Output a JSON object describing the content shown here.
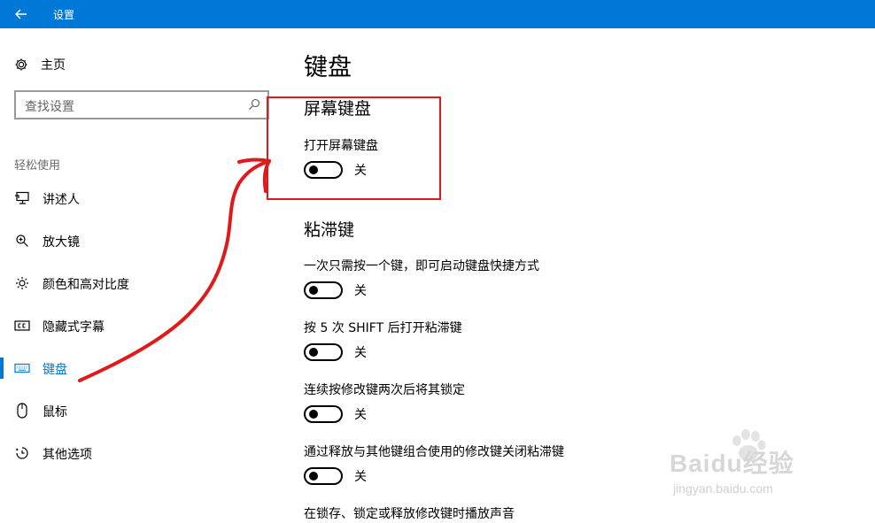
{
  "window": {
    "title": "设置"
  },
  "sidebar": {
    "home_label": "主页",
    "search_placeholder": "查找设置",
    "section_label": "轻松使用",
    "items": [
      {
        "label": "讲述人",
        "icon": "narrator-icon"
      },
      {
        "label": "放大镜",
        "icon": "magnifier-icon"
      },
      {
        "label": "颜色和高对比度",
        "icon": "brightness-icon"
      },
      {
        "label": "隐藏式字幕",
        "icon": "closed-caption-icon"
      },
      {
        "label": "键盘",
        "icon": "keyboard-icon",
        "selected": true
      },
      {
        "label": "鼠标",
        "icon": "mouse-icon"
      },
      {
        "label": "其他选项",
        "icon": "other-options-icon"
      }
    ]
  },
  "main": {
    "page_title": "键盘",
    "onscreen": {
      "title": "屏幕键盘",
      "setting_label": "打开屏幕键盘",
      "toggle_state": "关"
    },
    "sticky": {
      "title": "粘滞键",
      "settings": [
        {
          "label": "一次只需按一个键，即可启动键盘快捷方式",
          "state": "关"
        },
        {
          "label": "按 5 次 SHIFT 后打开粘滞键",
          "state": "关"
        },
        {
          "label": "连续按修改键两次后将其锁定",
          "state": "关"
        },
        {
          "label": "通过释放与其他键组合使用的修改键关闭粘滞键",
          "state": "关"
        },
        {
          "label": "在锁存、锁定或释放修改键时播放声音"
        }
      ]
    }
  },
  "watermark": {
    "logo": "Baidu经验",
    "url": "jingyan.baidu.com"
  },
  "colors": {
    "accent": "#0078d7",
    "annotation": "#e01a1a"
  }
}
